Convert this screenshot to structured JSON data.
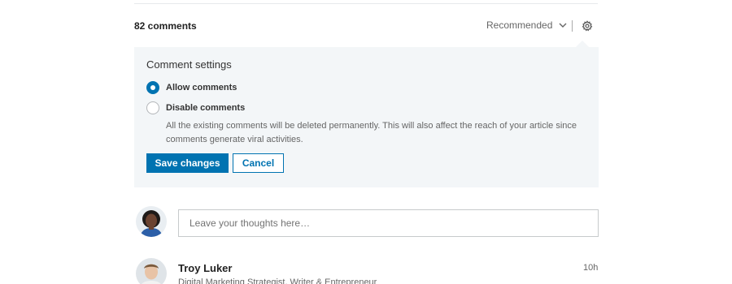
{
  "comments": {
    "count_label": "82 comments",
    "sort_label": "Recommended"
  },
  "settings": {
    "title": "Comment settings",
    "options": [
      {
        "label": "Allow comments",
        "checked": true
      },
      {
        "label": "Disable comments",
        "checked": false
      }
    ],
    "disable_note": "All the existing comments will be deleted permanently. This will also affect the reach of your article since comments generate viral activities.",
    "save_label": "Save changes",
    "cancel_label": "Cancel"
  },
  "composer": {
    "placeholder": "Leave your thoughts here…"
  },
  "first_comment": {
    "author": "Troy Luker",
    "headline": "Digital Marketing Strategist, Writer & Entrepreneur",
    "time": "10h"
  },
  "icons": {
    "sort": "chevron-down-icon",
    "settings": "gear-icon"
  },
  "colors": {
    "accent": "#0073b1",
    "panel_bg": "#f3f6f8"
  }
}
